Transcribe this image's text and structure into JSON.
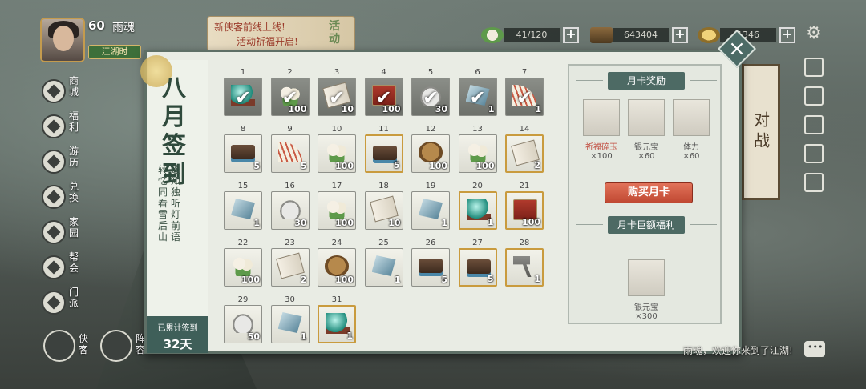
{
  "player": {
    "level": "60",
    "name": "雨魂",
    "title": "江湖时"
  },
  "banner": {
    "line1": "新侠客前线上线!",
    "line2": "活动祈福开启!",
    "tag": "活动"
  },
  "resources": [
    {
      "icon": "bun-icon",
      "value": "41/120"
    },
    {
      "icon": "wood-icon",
      "value": "643404"
    },
    {
      "icon": "ingot-icon",
      "value": "1346"
    }
  ],
  "left_nav": [
    {
      "label": "商城",
      "icon": "shop-icon"
    },
    {
      "label": "福利",
      "icon": "gift-icon"
    },
    {
      "label": "游历",
      "icon": "horse-icon"
    },
    {
      "label": "兑换",
      "icon": "exchange-icon"
    },
    {
      "label": "家园",
      "icon": "house-icon"
    },
    {
      "label": "帮会",
      "icon": "guild-icon"
    },
    {
      "label": "门派",
      "icon": "sect-icon"
    }
  ],
  "bottom_buttons": [
    {
      "label": "侠客",
      "icon": "hero-icon"
    },
    {
      "label": "阵容",
      "icon": "formation-icon"
    }
  ],
  "signin": {
    "title": "八月签到",
    "poem_col1": "遥知独听灯前语",
    "poem_col2": "转忆同看雪后山",
    "total_label": "已累计签到",
    "total_value": "32天"
  },
  "days": [
    {
      "day": "1",
      "item": "orb",
      "qty": "",
      "claimed": true,
      "gold": false
    },
    {
      "day": "2",
      "item": "bun",
      "qty": "100",
      "claimed": true,
      "gold": false
    },
    {
      "day": "3",
      "item": "scroll",
      "qty": "10",
      "claimed": true,
      "gold": false
    },
    {
      "day": "4",
      "item": "banner",
      "qty": "100",
      "claimed": true,
      "gold": false
    },
    {
      "day": "5",
      "item": "ingot",
      "qty": "30",
      "claimed": true,
      "gold": false
    },
    {
      "day": "6",
      "item": "stone",
      "qty": "1",
      "claimed": true,
      "gold": false
    },
    {
      "day": "7",
      "item": "fan",
      "qty": "1",
      "claimed": true,
      "gold": false
    },
    {
      "day": "8",
      "item": "chest",
      "qty": "5",
      "claimed": false,
      "gold": false
    },
    {
      "day": "9",
      "item": "fan",
      "qty": "5",
      "claimed": false,
      "gold": false
    },
    {
      "day": "10",
      "item": "bun",
      "qty": "100",
      "claimed": false,
      "gold": false
    },
    {
      "day": "11",
      "item": "chest",
      "qty": "5",
      "claimed": false,
      "gold": true
    },
    {
      "day": "12",
      "item": "token",
      "qty": "100",
      "claimed": false,
      "gold": false
    },
    {
      "day": "13",
      "item": "bun",
      "qty": "100",
      "claimed": false,
      "gold": false
    },
    {
      "day": "14",
      "item": "scroll",
      "qty": "2",
      "claimed": false,
      "gold": true
    },
    {
      "day": "15",
      "item": "stone",
      "qty": "1",
      "claimed": false,
      "gold": false
    },
    {
      "day": "16",
      "item": "ingot",
      "qty": "30",
      "claimed": false,
      "gold": false
    },
    {
      "day": "17",
      "item": "bun",
      "qty": "100",
      "claimed": false,
      "gold": false
    },
    {
      "day": "18",
      "item": "scroll",
      "qty": "10",
      "claimed": false,
      "gold": false
    },
    {
      "day": "19",
      "item": "stone",
      "qty": "1",
      "claimed": false,
      "gold": false
    },
    {
      "day": "20",
      "item": "orb",
      "qty": "1",
      "claimed": false,
      "gold": true
    },
    {
      "day": "21",
      "item": "banner",
      "qty": "100",
      "claimed": false,
      "gold": true
    },
    {
      "day": "22",
      "item": "bun",
      "qty": "100",
      "claimed": false,
      "gold": false
    },
    {
      "day": "23",
      "item": "scroll",
      "qty": "2",
      "claimed": false,
      "gold": false
    },
    {
      "day": "24",
      "item": "token",
      "qty": "100",
      "claimed": false,
      "gold": false
    },
    {
      "day": "25",
      "item": "stone",
      "qty": "1",
      "claimed": false,
      "gold": false
    },
    {
      "day": "26",
      "item": "chest",
      "qty": "5",
      "claimed": false,
      "gold": false
    },
    {
      "day": "27",
      "item": "chest",
      "qty": "5",
      "claimed": false,
      "gold": true
    },
    {
      "day": "28",
      "item": "hammer",
      "qty": "1",
      "claimed": false,
      "gold": true
    },
    {
      "day": "29",
      "item": "ingot",
      "qty": "50",
      "claimed": false,
      "gold": false
    },
    {
      "day": "30",
      "item": "stone",
      "qty": "1",
      "claimed": false,
      "gold": false
    },
    {
      "day": "31",
      "item": "orb",
      "qty": "1",
      "claimed": false,
      "gold": true
    }
  ],
  "monthly_card": {
    "reward_title": "月卡奖励",
    "rewards": [
      {
        "name": "祈福碎玉",
        "qty": "×100",
        "item": "orb",
        "red": true
      },
      {
        "name": "银元宝",
        "qty": "×60",
        "item": "ingot",
        "red": false
      },
      {
        "name": "体力",
        "qty": "×60",
        "item": "bun",
        "red": false
      }
    ],
    "buy_label": "购买月卡",
    "bonus_title": "月卡巨额福利",
    "bonus": {
      "name": "银元宝",
      "qty": "×300",
      "item": "ingot"
    }
  },
  "side_scroll": "对战",
  "chat": "雨魂，欢迎你来到了江湖!"
}
